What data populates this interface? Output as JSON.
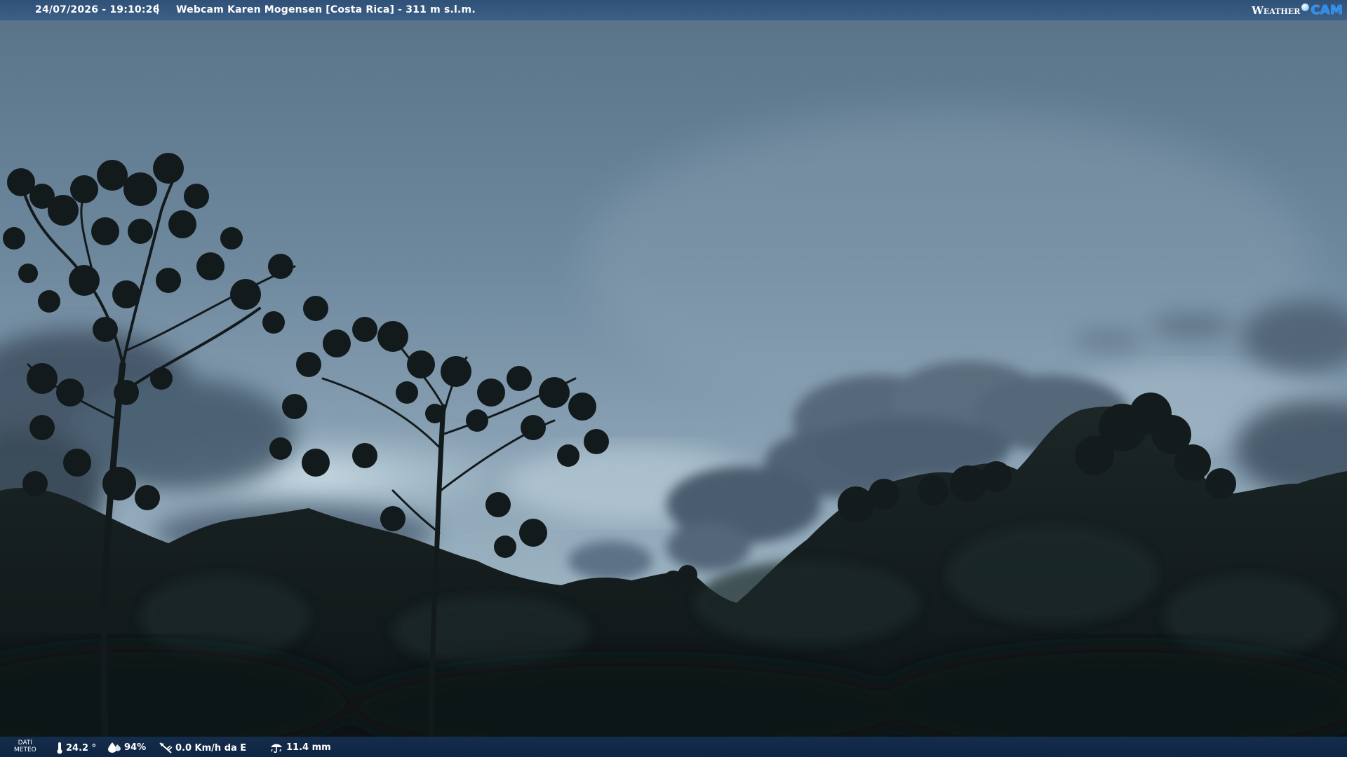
{
  "header": {
    "timestamp": "24/07/2026 - 19:10:26",
    "separator": "|",
    "title": "Webcam Karen Mogensen [Costa Rica]  - 311 m s.l.m."
  },
  "logo": {
    "weather_text": "Weather",
    "cam_text": "CAM"
  },
  "weather_data": {
    "label_line1": "DATI",
    "label_line2": "METEO",
    "temperature": "24.2 °",
    "humidity": "94%",
    "wind": "0.0 Km/h da E",
    "rain": "11.4 mm"
  },
  "colors": {
    "bar_top": "#2c4e76",
    "bar_bottom": "#0e2646",
    "sky_top": "#5d7890",
    "sky_light": "#bcd0dc",
    "forest": "#141c1c",
    "logo_accent": "#1e90ff"
  },
  "icons": {
    "temperature": "thermometer-icon",
    "humidity": "humidity-drop-icon",
    "wind": "wind-vane-icon",
    "rain": "rain-gauge-icon"
  }
}
